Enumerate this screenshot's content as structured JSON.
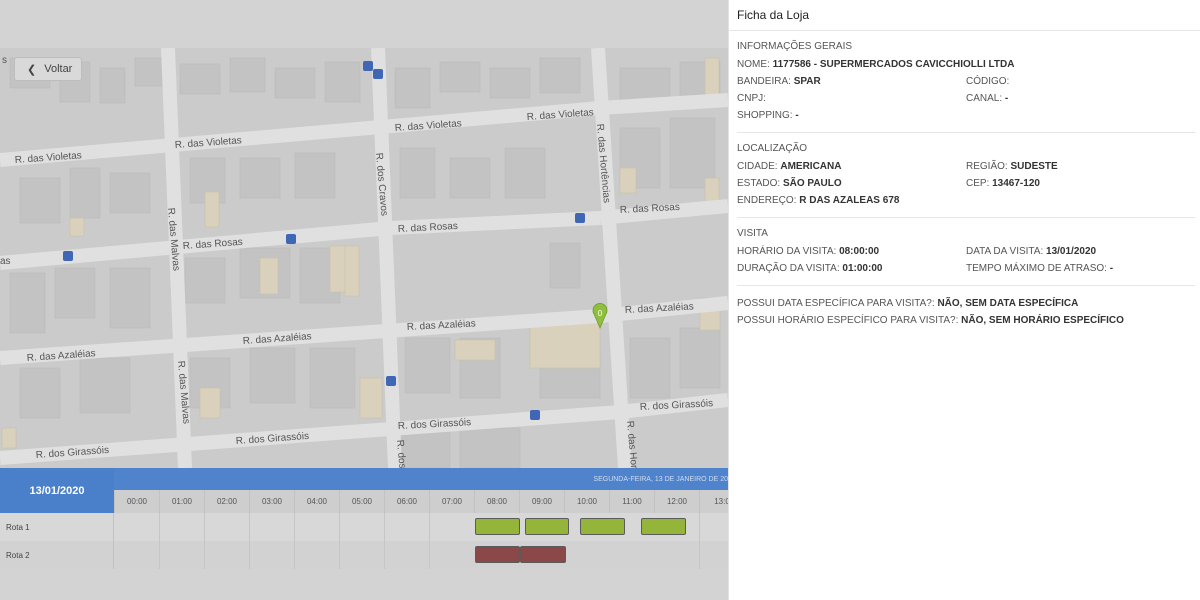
{
  "map": {
    "back_label": "Voltar",
    "marker_label": "0",
    "streets": {
      "violetas_1": "R. das Violetas",
      "violetas_2": "R. das Violetas",
      "violetas_3": "R. das Violetas",
      "violetas_left": "R. das Violetas",
      "rosas_1": "R. das Rosas",
      "rosas_2": "R. das Rosas",
      "rosas_3": "R. das Rosas",
      "rosas_left": "as",
      "azaleias_1": "R. das Azaléias",
      "azaleias_2": "R. das Azaléias",
      "azaleias_3": "R. das Azaléias",
      "girassois_1": "R. dos Girassóis",
      "girassois_2": "R. dos Girassóis",
      "girassois_3": "R. dos Girassóis",
      "girassois_4": "R. dos Girassóis",
      "malvas_1": "R. das Malvas",
      "malvas_2": "R. das Malvas",
      "cravos_1": "R. dos Cravos",
      "cravos_2": "R. dos",
      "hortencias_1": "R. das Hortências",
      "hortencias_2": "R. das Hor",
      "edge_s": "s"
    }
  },
  "timeline": {
    "date": "13/01/2020",
    "header": "SEGUNDA-FEIRA, 13 DE JANEIRO DE 20",
    "hours": [
      "00:00",
      "01:00",
      "02:00",
      "03:00",
      "04:00",
      "05:00",
      "06:00",
      "07:00",
      "08:00",
      "09:00",
      "10:00",
      "11:00",
      "12:00",
      "13:0"
    ],
    "rows": [
      {
        "label": "Rota 1"
      },
      {
        "label": "Rota 2"
      }
    ]
  },
  "panel": {
    "title": "Ficha da Loja",
    "general": {
      "title": "INFORMAÇÕES GERAIS",
      "nome_label": "NOME:",
      "nome_value": "1177586 - SUPERMERCADOS CAVICCHIOLLI LTDA",
      "bandeira_label": "BANDEIRA:",
      "bandeira_value": "SPAR",
      "codigo_label": "CÓDIGO:",
      "codigo_value": "",
      "cnpj_label": "CNPJ:",
      "cnpj_value": "",
      "canal_label": "CANAL:",
      "canal_value": "-",
      "shopping_label": "SHOPPING:",
      "shopping_value": "-"
    },
    "location": {
      "title": "LOCALIZAÇÃO",
      "cidade_label": "CIDADE:",
      "cidade_value": "AMERICANA",
      "regiao_label": "REGIÃO:",
      "regiao_value": "SUDESTE",
      "estado_label": "ESTADO:",
      "estado_value": "SÃO PAULO",
      "cep_label": "CEP:",
      "cep_value": "13467-120",
      "endereco_label": "ENDEREÇO:",
      "endereco_value": "R DAS AZALEAS 678"
    },
    "visit": {
      "title": "VISITA",
      "horario_label": "HORÁRIO DA VISITA:",
      "horario_value": "08:00:00",
      "data_label": "DATA DA VISITA:",
      "data_value": "13/01/2020",
      "duracao_label": "DURAÇÃO DA VISITA:",
      "duracao_value": "01:00:00",
      "atraso_label": "TEMPO MÁXIMO DE ATRASO:",
      "atraso_value": "-"
    },
    "specific": {
      "data_esp_label": "POSSUI DATA ESPECÍFICA PARA VISITA?:",
      "data_esp_value": "NÃO, SEM DATA ESPECÍFICA",
      "hora_esp_label": "POSSUI HORÁRIO ESPECÍFICO PARA VISITA?:",
      "hora_esp_value": "NÃO, SEM HORÁRIO ESPECÍFICO"
    }
  }
}
